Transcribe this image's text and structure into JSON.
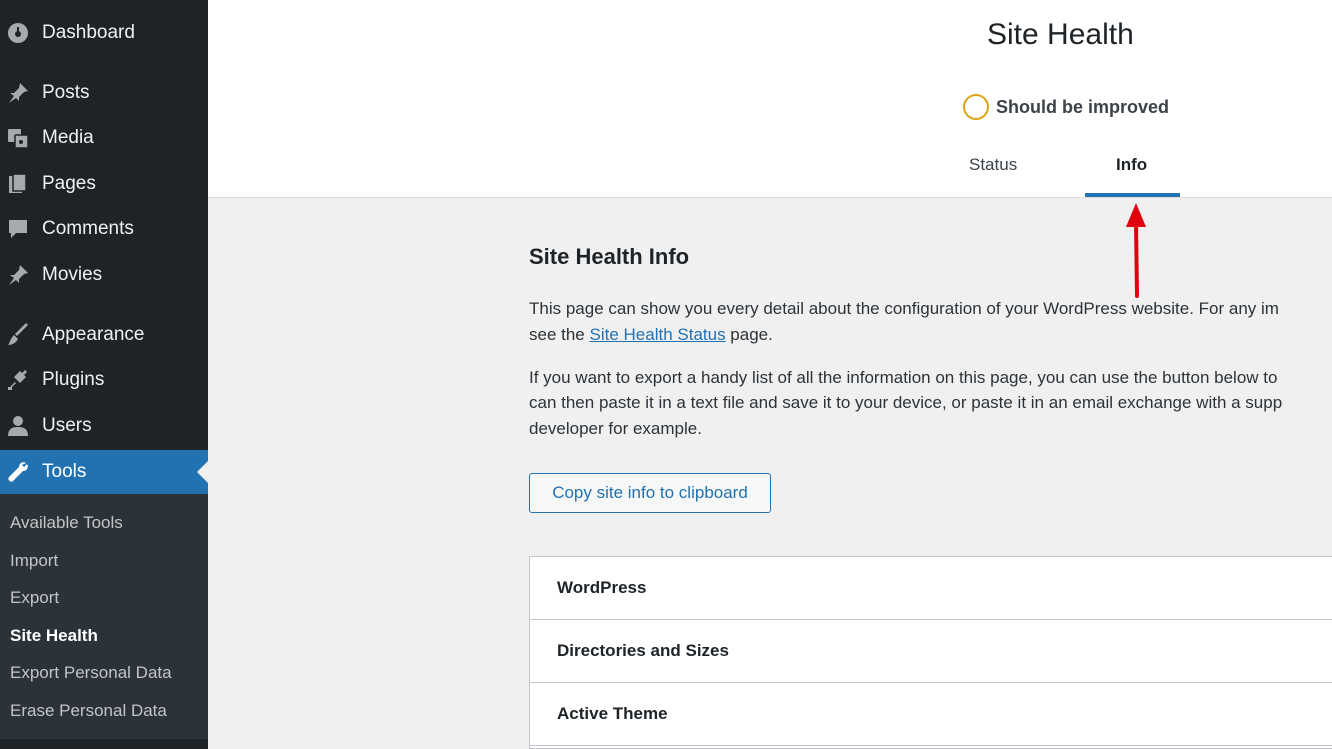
{
  "sidebar": {
    "items": [
      {
        "label": "Dashboard",
        "icon": "dashboard-icon"
      },
      {
        "label": "Posts",
        "icon": "pin-icon"
      },
      {
        "label": "Media",
        "icon": "media-icon"
      },
      {
        "label": "Pages",
        "icon": "pages-icon"
      },
      {
        "label": "Comments",
        "icon": "comment-icon"
      },
      {
        "label": "Movies",
        "icon": "pin-icon"
      },
      {
        "label": "Appearance",
        "icon": "brush-icon"
      },
      {
        "label": "Plugins",
        "icon": "plug-icon"
      },
      {
        "label": "Users",
        "icon": "user-icon"
      },
      {
        "label": "Tools",
        "icon": "wrench-icon"
      }
    ],
    "submenu": [
      "Available Tools",
      "Import",
      "Export",
      "Site Health",
      "Export Personal Data",
      "Erase Personal Data"
    ]
  },
  "header": {
    "title": "Site Health",
    "status": "Should be improved",
    "tabs": [
      "Status",
      "Info"
    ]
  },
  "main": {
    "section_title": "Site Health Info",
    "para1_line1": "This page can show you every detail about the configuration of your WordPress website. For any im",
    "para1_line2_pre": "see the ",
    "para1_link": "Site Health Status",
    "para1_line2_post": " page.",
    "para2_line1": "If you want to export a handy list of all the information on this page, you can use the button below to",
    "para2_line2": "can then paste it in a text file and save it to your device, or paste it in an email exchange with a supp",
    "para2_line3": "developer for example.",
    "copy_button": "Copy site info to clipboard",
    "accordion": [
      "WordPress",
      "Directories and Sizes",
      "Active Theme"
    ]
  },
  "colors": {
    "sidebar_bg": "#1d2327",
    "accent": "#2271b1",
    "status_ring": "#dba617",
    "annotation_arrow": "#e0000e"
  }
}
